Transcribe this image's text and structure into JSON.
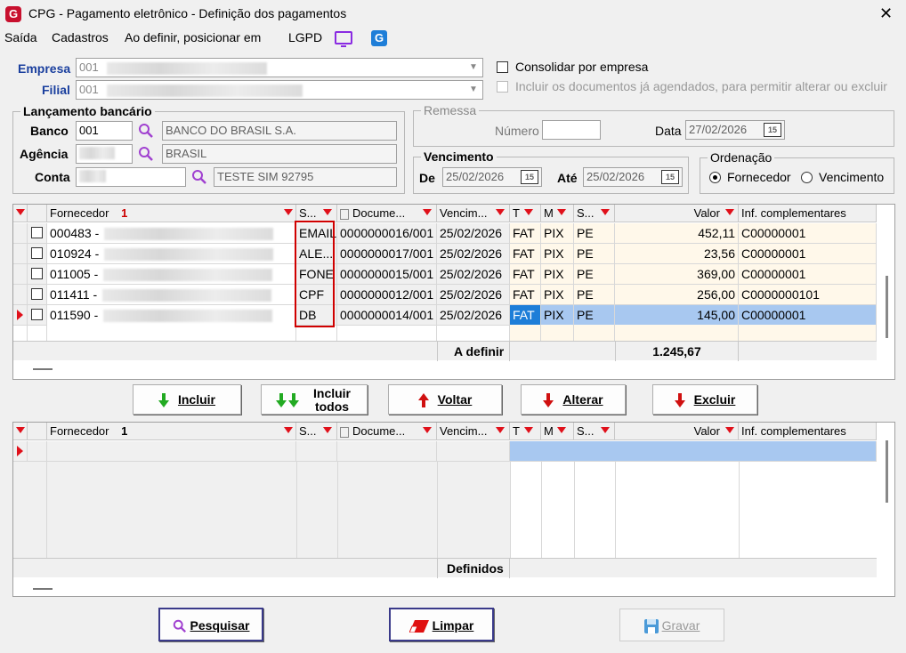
{
  "window": {
    "title": "CPG - Pagamento eletrônico - Definição dos pagamentos",
    "close_glyph": "✕",
    "logo_letter": "G"
  },
  "menu": [
    {
      "label": "Saída"
    },
    {
      "label": "Cadastros"
    },
    {
      "label": "Ao definir, posicionar em"
    },
    {
      "label": "LGPD"
    }
  ],
  "filters": {
    "empresa_label": "Empresa",
    "empresa_value": "001",
    "filial_label": "Filial",
    "filial_value": "001",
    "consolidar_label": "Consolidar por empresa",
    "incluir_agendados_label": "Incluir os documentos já agendados, para permitir alterar ou excluir"
  },
  "lancamento": {
    "title": "Lançamento bancário",
    "banco_label": "Banco",
    "banco_value": "001",
    "banco_name": "BANCO DO BRASIL S.A.",
    "agencia_label": "Agência",
    "agencia_name": "BRASIL",
    "conta_label": "Conta",
    "conta_name": "TESTE SIM 92795"
  },
  "remessa": {
    "title": "Remessa",
    "numero_label": "Número",
    "numero_value": "",
    "data_label": "Data",
    "data_value": "27/02/2026",
    "cal": "15"
  },
  "vencimento": {
    "title": "Vencimento",
    "de_label": "De",
    "de_value": "25/02/2026",
    "ate_label": "Até",
    "ate_value": "25/02/2026",
    "cal": "15"
  },
  "ordenacao": {
    "title": "Ordenação",
    "opt1": "Fornecedor",
    "opt2": "Vencimento",
    "selected": "Fornecedor"
  },
  "grid_top": {
    "headers": [
      "Fornecedor",
      "S...",
      "Docume...",
      "Vencim...",
      "T",
      "M",
      "S...",
      "Valor",
      "Inf. complementares"
    ],
    "sort_marker": "1",
    "rows": [
      {
        "fornecedor": "000483 -",
        "s": "EMAIL",
        "doc": "0000000016/001",
        "venc": "25/02/2026",
        "t": "FAT",
        "m": "PIX",
        "s2": "PE",
        "valor": "452,11",
        "inf": "C00000001"
      },
      {
        "fornecedor": "010924 -",
        "s": "ALE...",
        "doc": "0000000017/001",
        "venc": "25/02/2026",
        "t": "FAT",
        "m": "PIX",
        "s2": "PE",
        "valor": "23,56",
        "inf": "C00000001"
      },
      {
        "fornecedor": "011005 -",
        "s": "FONE",
        "doc": "0000000015/001",
        "venc": "25/02/2026",
        "t": "FAT",
        "m": "PIX",
        "s2": "PE",
        "valor": "369,00",
        "inf": "C00000001"
      },
      {
        "fornecedor": "011411 -",
        "s": "CPF",
        "doc": "0000000012/001",
        "venc": "25/02/2026",
        "t": "FAT",
        "m": "PIX",
        "s2": "PE",
        "valor": "256,00",
        "inf": "C0000000101"
      },
      {
        "fornecedor": "011590 -",
        "s": "DB",
        "doc": "0000000014/001",
        "venc": "25/02/2026",
        "t": "FAT",
        "m": "PIX",
        "s2": "PE",
        "valor": "145,00",
        "inf": "C00000001"
      }
    ],
    "footer_label": "A definir",
    "footer_total": "1.245,67"
  },
  "actions": {
    "incluir": "Incluir",
    "incluir_todos_1": "Incluir",
    "incluir_todos_2": "todos",
    "voltar": "Voltar",
    "alterar": "Alterar",
    "excluir": "Excluir"
  },
  "grid_bottom": {
    "headers": [
      "Fornecedor",
      "S...",
      "Docume...",
      "Vencim...",
      "T",
      "M",
      "S...",
      "Valor",
      "Inf. complementares"
    ],
    "sort_marker": "1",
    "footer_label": "Definidos"
  },
  "footer_buttons": {
    "pesquisar": "Pesquisar",
    "limpar": "Limpar",
    "gravar": "Gravar"
  },
  "colors": {
    "selection": "#a8c8f0",
    "highlight_box": "#d00000",
    "accent_red": "#e0101a"
  }
}
